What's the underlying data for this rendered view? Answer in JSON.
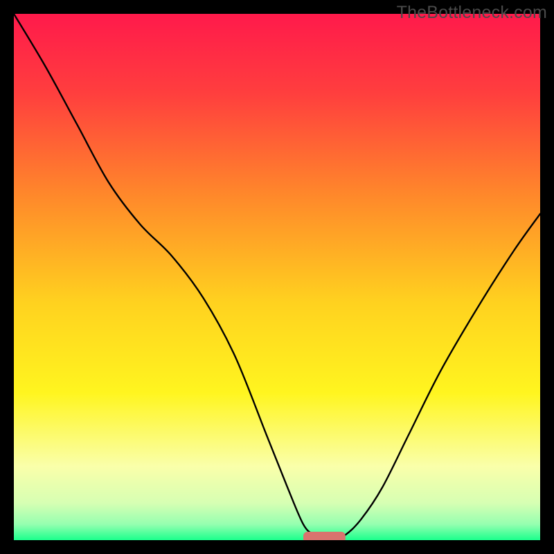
{
  "watermark": "TheBottleneck.com",
  "chart_data": {
    "type": "line",
    "title": "",
    "xlabel": "",
    "ylabel": "",
    "xlim": [
      0,
      100
    ],
    "ylim": [
      0,
      100
    ],
    "grid": false,
    "legend": false,
    "annotations": [],
    "background_gradient": {
      "stops": [
        {
          "offset": 0,
          "color": "#ff1a4b"
        },
        {
          "offset": 15,
          "color": "#ff3e3e"
        },
        {
          "offset": 35,
          "color": "#ff8a2a"
        },
        {
          "offset": 55,
          "color": "#ffd21f"
        },
        {
          "offset": 72,
          "color": "#fff51f"
        },
        {
          "offset": 86,
          "color": "#faffaa"
        },
        {
          "offset": 93,
          "color": "#d6ffb3"
        },
        {
          "offset": 97,
          "color": "#95ffb0"
        },
        {
          "offset": 100,
          "color": "#1aff8c"
        }
      ]
    },
    "series": [
      {
        "name": "bottleneck-curve",
        "color": "#000000",
        "width": 2.4,
        "x": [
          0,
          6,
          12,
          18,
          24,
          30,
          36,
          42,
          48,
          52,
          55,
          57,
          58.5,
          61,
          63,
          66,
          70,
          75,
          81,
          88,
          95,
          100
        ],
        "y": [
          100,
          90,
          79,
          68,
          60,
          54,
          46,
          35,
          20,
          10,
          3,
          1,
          0.5,
          0.5,
          1,
          4,
          10,
          20,
          32,
          44,
          55,
          62
        ]
      }
    ],
    "marker": {
      "name": "optimal-range-marker",
      "color": "#d9736e",
      "x_start": 55,
      "x_end": 63,
      "y": 0.5,
      "thickness": 2.2
    }
  }
}
